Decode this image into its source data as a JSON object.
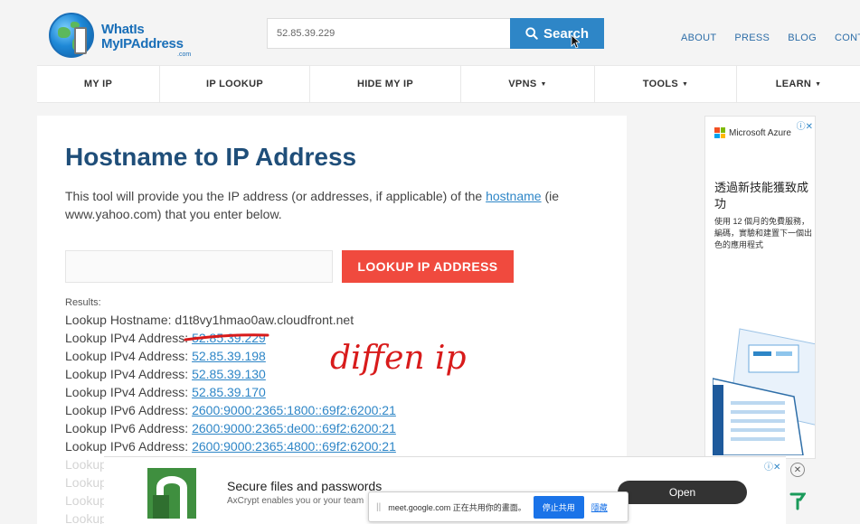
{
  "header": {
    "logo": {
      "line1": "WhatIs",
      "line2": "MyIPAddress",
      "line3": ".com"
    },
    "search": {
      "value": "52.85.39.229",
      "button_label": "Search"
    },
    "top_links": [
      "ABOUT",
      "PRESS",
      "BLOG",
      "CONTAC"
    ]
  },
  "nav": {
    "items": [
      {
        "label": "MY IP",
        "dropdown": false
      },
      {
        "label": "IP LOOKUP",
        "dropdown": false
      },
      {
        "label": "HIDE MY IP",
        "dropdown": false
      },
      {
        "label": "VPNS",
        "dropdown": true
      },
      {
        "label": "TOOLS",
        "dropdown": true
      },
      {
        "label": "LEARN",
        "dropdown": true
      }
    ],
    "caret": "▼"
  },
  "main": {
    "title": "Hostname to IP Address",
    "intro_before": "This tool will provide you the IP address (or addresses, if applicable) of the ",
    "intro_link": "hostname",
    "intro_after": " (ie www.yahoo.com) that you enter below.",
    "lookup_button": "LOOKUP IP ADDRESS",
    "results_label": "Results:",
    "hostname_line": {
      "label": "Lookup Hostname: ",
      "value": "d1t8vy1hmao0aw.cloudfront.net"
    },
    "results": [
      {
        "label": "Lookup IPv4 Address: ",
        "value": "52.85.39.229"
      },
      {
        "label": "Lookup IPv4 Address: ",
        "value": "52.85.39.198"
      },
      {
        "label": "Lookup IPv4 Address: ",
        "value": "52.85.39.130"
      },
      {
        "label": "Lookup IPv4 Address: ",
        "value": "52.85.39.170"
      },
      {
        "label": "Lookup IPv6 Address: ",
        "value": "2600:9000:2365:1800::69f2:6200:21"
      },
      {
        "label": "Lookup IPv6 Address: ",
        "value": "2600:9000:2365:de00::69f2:6200:21"
      },
      {
        "label": "Lookup IPv6 Address: ",
        "value": "2600:9000:2365:4800::69f2:6200:21"
      }
    ],
    "faded_rows": [
      "Lookup",
      "Lookup",
      "Lookup",
      "Lookup"
    ],
    "annotation": "diffen ip"
  },
  "ad_right": {
    "brand": "Microsoft Azure",
    "headline": "透過新技能獲致成功",
    "body": "使用 12 個月的免費服務，編碼，實驗和建置下一個出色的應用程式",
    "close": "ⓘ✕"
  },
  "ad_bottom": {
    "title": "Secure files and passwords",
    "subtitle": "AxCrypt enables you or your team",
    "open_button": "Open",
    "close": "ⓘ✕"
  },
  "share_bar": {
    "grip": "||",
    "text": "meet.google.com 正在共用你的畫面。",
    "stop_button": "停止共用",
    "hide_link": "隱藏"
  },
  "colors": {
    "title": "#1f4e79",
    "link": "#2e86c7",
    "lookup_button": "#f04a3e",
    "search_button": "#2e86c7",
    "annotation": "#d81b1b"
  }
}
